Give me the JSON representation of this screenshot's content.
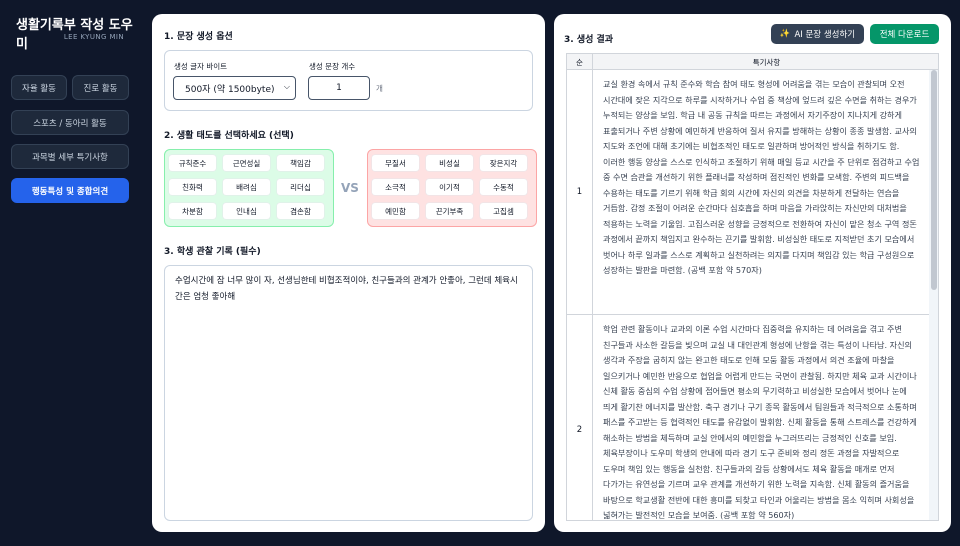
{
  "sidebar": {
    "title": "생활기록부 작성 도우미",
    "author": "LEE KYUNG MIN",
    "nav": {
      "autonomy": "자율 활동",
      "career": "진로 활동",
      "sports": "스포츠 / 동아리 활동",
      "subject": "과목별 세부 특기사항",
      "behavior": "행동특성 및 종합의견"
    }
  },
  "options": {
    "title": "1. 문장 생성 옵션",
    "length_label": "생성 글자 바이트",
    "length_value": "500자 (약 1500byte)",
    "count_label": "생성 문장 개수",
    "count_value": "1",
    "count_unit": "개"
  },
  "attitude": {
    "title": "2. 생활 태도를 선택하세요 (선택)",
    "positive": [
      "규칙준수",
      "근면성실",
      "책임감",
      "친화력",
      "배려심",
      "리더십",
      "차분함",
      "인내심",
      "겸손함"
    ],
    "vs": "VS",
    "negative": [
      "무질서",
      "비성실",
      "잦은지각",
      "소극적",
      "이기적",
      "수동적",
      "예민함",
      "끈기부족",
      "고집셈"
    ]
  },
  "observation": {
    "title": "3. 학생 관찰 기록 (필수)",
    "text": "수업시간에 잠 너무 많이 자, 선생님한테 비협조적이야, 친구들과의 관계가 안좋아, 그런데 체육시간은 엄청 좋아해"
  },
  "result": {
    "title": "3. 생성 결과",
    "ai_button": "AI 문장 생성하기",
    "download_button": "전체 다운로드",
    "col_no": "순",
    "col_body": "특기사항",
    "rows": [
      {
        "no": "1",
        "text": "교실 환경 속에서 규칙 준수와 학습 참여 태도 형성에 어려움을 겪는 모습이 관찰되며 오전 시간대에 잦은 지각으로 하루를 시작하거나 수업 중 책상에 엎드려 깊은 수면을 취하는 경우가 누적되는 양상을 보임. 학급 내 공동 규칙을 따르는 과정에서 자기주장이 지나치게 강하게 표출되거나 주변 상황에 예민하게 반응하여 질서 유지를 방해하는 상황이 종종 발생함. 교사의 지도와 조언에 대해 초기에는 비협조적인 태도로 일관하며 방어적인 방식을 취하기도 함. 이러한 행동 양상을 스스로 인식하고 조절하기 위해 매일 등교 시간을 주 단위로 점검하고 수업 중 수면 습관을 개선하기 위한 플래너를 작성하며 점진적인 변화를 모색함. 주변의 피드백을 수용하는 태도를 기르기 위해 학급 회의 시간에 자신의 의견을 차분하게 전달하는 연습을 거듭함. 감정 조절이 어려운 순간마다 심호흡을 하며 마음을 가라앉히는 자신만의 대처법을 적용하는 노력을 기울임. 고집스러운 성향을 긍정적으로 전환하여 자신이 맡은 청소 구역 정돈 과정에서 끝까지 책임지고 완수하는 끈기를 발휘함. 비성실한 태도로 지적받던 초기 모습에서 벗어나 하루 일과를 스스로 계획하고 실천하려는 의지를 다지며 책임감 있는 학급 구성원으로 성장하는 발판을 마련함. (공백 포함 약 570자)"
      },
      {
        "no": "2",
        "text": "학업 관련 활동이나 교과의 이론 수업 시간마다 집중력을 유지하는 데 어려움을 겪고 주변 친구들과 사소한 갈등을 빚으며 교실 내 대인관계 형성에 난항을 겪는 특성이 나타남. 자신의 생각과 주장을 굽히지 않는 완고한 태도로 인해 모둠 활동 과정에서 의견 조율에 마찰을 일으키거나 예민한 반응으로 협업을 어렵게 만드는 국면이 관찰됨. 하지만 체육 교과 시간이나 신체 활동 중심의 수업 상황에 접어들면 평소의 무기력하고 비성실한 모습에서 벗어나 눈에 띄게 활기찬 에너지를 발산함. 축구 경기나 구기 종목 활동에서 팀원들과 적극적으로 소통하며 패스를 주고받는 등 협력적인 태도를 유감없이 발휘함. 신체 활동을 통해 스트레스를 건강하게 해소하는 방법을 체득하며 교실 안에서의 예민함을 누그러뜨리는 긍정적인 신호를 보임. 체육부장이나 도우미 학생의 안내에 따라 경기 도구 준비와 정리 정돈 과정을 자발적으로 도우며 책임 있는 행동을 실천함. 친구들과의 갈등 상황에서도 체육 활동을 매개로 먼저 다가가는 유연성을 기르며 교우 관계를 개선하기 위한 노력을 지속함. 신체 활동의 즐거움을 바탕으로 학교생활 전반에 대한 흥미를 되찾고 타인과 어울리는 방법을 몸소 익히며 사회성을 넓혀가는 발전적인 모습을 보여줌. (공백 포함 약 560자)"
      }
    ]
  },
  "colors": {
    "sidebar_bg": "#0f172a",
    "active_nav": "#2563eb",
    "ai_button": "#334155",
    "download_button": "#059669",
    "positive_bg": "#dcfce7",
    "negative_bg": "#fee2e2"
  }
}
